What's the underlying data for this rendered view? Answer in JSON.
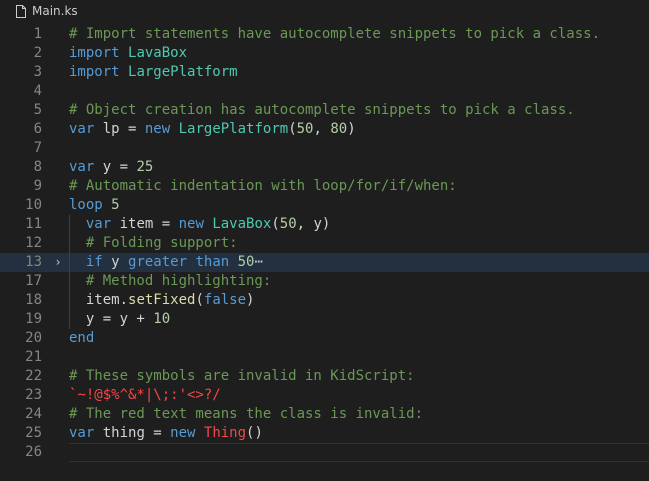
{
  "tab": {
    "filename": "Main.ks",
    "icon": "file-icon"
  },
  "gutter": {
    "fold_icon": "chevron-right-icon",
    "fold_glyph": "›"
  },
  "lines": [
    {
      "n": "1",
      "tokens": [
        {
          "c": "c",
          "t": "# Import statements have autocomplete snippets to pick a class."
        }
      ]
    },
    {
      "n": "2",
      "tokens": [
        {
          "c": "k",
          "t": "import"
        },
        {
          "c": "d",
          "t": " "
        },
        {
          "c": "t",
          "t": "LavaBox"
        }
      ]
    },
    {
      "n": "3",
      "tokens": [
        {
          "c": "k",
          "t": "import"
        },
        {
          "c": "d",
          "t": " "
        },
        {
          "c": "t",
          "t": "LargePlatform"
        }
      ]
    },
    {
      "n": "4",
      "tokens": []
    },
    {
      "n": "5",
      "tokens": [
        {
          "c": "c",
          "t": "# Object creation has autocomplete snippets to pick a class."
        }
      ]
    },
    {
      "n": "6",
      "tokens": [
        {
          "c": "k",
          "t": "var"
        },
        {
          "c": "d",
          "t": " lp = "
        },
        {
          "c": "k",
          "t": "new"
        },
        {
          "c": "d",
          "t": " "
        },
        {
          "c": "t",
          "t": "LargePlatform"
        },
        {
          "c": "d",
          "t": "("
        },
        {
          "c": "n",
          "t": "50"
        },
        {
          "c": "d",
          "t": ", "
        },
        {
          "c": "n",
          "t": "80"
        },
        {
          "c": "d",
          "t": ")"
        }
      ]
    },
    {
      "n": "7",
      "tokens": []
    },
    {
      "n": "8",
      "tokens": [
        {
          "c": "k",
          "t": "var"
        },
        {
          "c": "d",
          "t": " y = "
        },
        {
          "c": "n",
          "t": "25"
        }
      ]
    },
    {
      "n": "9",
      "tokens": [
        {
          "c": "c",
          "t": "# Automatic indentation with loop/for/if/when:"
        }
      ]
    },
    {
      "n": "10",
      "tokens": [
        {
          "c": "k",
          "t": "loop"
        },
        {
          "c": "d",
          "t": " "
        },
        {
          "c": "n",
          "t": "5"
        }
      ]
    },
    {
      "n": "11",
      "indent": true,
      "tokens": [
        {
          "c": "d",
          "t": "  "
        },
        {
          "c": "k",
          "t": "var"
        },
        {
          "c": "d",
          "t": " item = "
        },
        {
          "c": "k",
          "t": "new"
        },
        {
          "c": "d",
          "t": " "
        },
        {
          "c": "t",
          "t": "LavaBox"
        },
        {
          "c": "d",
          "t": "("
        },
        {
          "c": "n",
          "t": "50"
        },
        {
          "c": "d",
          "t": ", y)"
        }
      ]
    },
    {
      "n": "12",
      "indent": true,
      "tokens": [
        {
          "c": "d",
          "t": "  "
        },
        {
          "c": "c",
          "t": "# Folding support:"
        }
      ]
    },
    {
      "n": "13",
      "indent": true,
      "current": true,
      "fold": true,
      "tokens": [
        {
          "c": "d",
          "t": "  "
        },
        {
          "c": "k",
          "t": "if"
        },
        {
          "c": "d",
          "t": " y "
        },
        {
          "c": "k",
          "t": "greater"
        },
        {
          "c": "d",
          "t": " "
        },
        {
          "c": "k",
          "t": "than"
        },
        {
          "c": "d",
          "t": " "
        },
        {
          "c": "n",
          "t": "50"
        },
        {
          "c": "ellipsis",
          "t": "⋯"
        }
      ]
    },
    {
      "n": "17",
      "indent": true,
      "tokens": [
        {
          "c": "d",
          "t": "  "
        },
        {
          "c": "c",
          "t": "# Method highlighting:"
        }
      ]
    },
    {
      "n": "18",
      "indent": true,
      "tokens": [
        {
          "c": "d",
          "t": "  item."
        },
        {
          "c": "f",
          "t": "setFixed"
        },
        {
          "c": "d",
          "t": "("
        },
        {
          "c": "k",
          "t": "false"
        },
        {
          "c": "d",
          "t": ")"
        }
      ]
    },
    {
      "n": "19",
      "indent": true,
      "tokens": [
        {
          "c": "d",
          "t": "  y = y + "
        },
        {
          "c": "n",
          "t": "10"
        }
      ]
    },
    {
      "n": "20",
      "tokens": [
        {
          "c": "k",
          "t": "end"
        }
      ]
    },
    {
      "n": "21",
      "tokens": []
    },
    {
      "n": "22",
      "tokens": [
        {
          "c": "c",
          "t": "# These symbols are invalid in KidScript:"
        }
      ]
    },
    {
      "n": "23",
      "tokens": [
        {
          "c": "r",
          "t": "`~!@$%^&*|\\;:'<>?/"
        }
      ]
    },
    {
      "n": "24",
      "tokens": [
        {
          "c": "c",
          "t": "# The red text means the class is invalid:"
        }
      ]
    },
    {
      "n": "25",
      "tokens": [
        {
          "c": "k",
          "t": "var"
        },
        {
          "c": "d",
          "t": " thing = "
        },
        {
          "c": "k",
          "t": "new"
        },
        {
          "c": "d",
          "t": " "
        },
        {
          "c": "r",
          "t": "Thing"
        },
        {
          "c": "d",
          "t": "()"
        }
      ]
    },
    {
      "n": "26",
      "cursor": true,
      "tokens": []
    }
  ]
}
